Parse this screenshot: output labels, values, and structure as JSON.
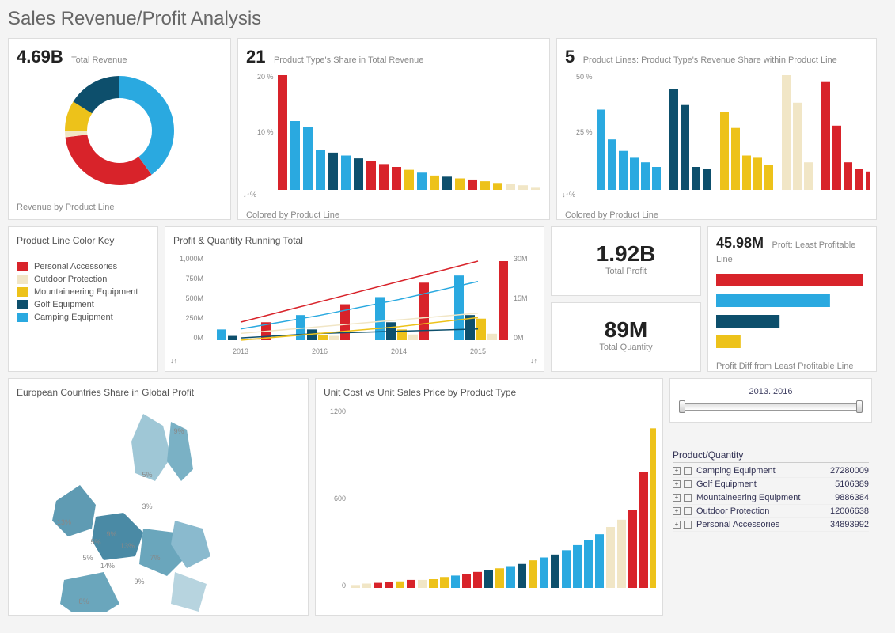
{
  "page_title": "Sales Revenue/Profit Analysis",
  "colors": {
    "red": "#d8232a",
    "cream": "#f1e6c6",
    "gold": "#edc21a",
    "navy": "#0d4f6c",
    "sky": "#2aa9e0"
  },
  "donut_card": {
    "kpi_value": "4.69B",
    "kpi_label": "Total Revenue",
    "caption": "Revenue by Product Line"
  },
  "share_card": {
    "kpi_value": "21",
    "kpi_label": "Product Type's Share in Total Revenue",
    "caption": "Colored by Product Line",
    "ymax_label": "20 %",
    "ymid_label": "10 %"
  },
  "lines_card": {
    "kpi_value": "5",
    "kpi_label": "Product Lines: Product Type's Revenue Share within Product Line",
    "caption": "Colored by Product Line",
    "ymax_label": "50 %",
    "ymid_label": "25 %"
  },
  "legend_card": {
    "title": "Product Line Color Key",
    "items": [
      {
        "label": "Personal Accessories",
        "color": "#d8232a"
      },
      {
        "label": "Outdoor Protection",
        "color": "#f1e6c6"
      },
      {
        "label": "Mountaineering Equipment",
        "color": "#edc21a"
      },
      {
        "label": "Golf Equipment",
        "color": "#0d4f6c"
      },
      {
        "label": "Camping Equipment",
        "color": "#2aa9e0"
      }
    ]
  },
  "running_card": {
    "title": "Profit & Quantity Running Total",
    "left_ticks": [
      "1,000M",
      "750M",
      "500M",
      "250M",
      "0M"
    ],
    "right_ticks": [
      "30M",
      "15M",
      "0M"
    ],
    "x_ticks": [
      "2013",
      "2016",
      "2014",
      "2015"
    ]
  },
  "total_profit": {
    "value": "1.92B",
    "label": "Total Profit"
  },
  "total_qty": {
    "value": "89M",
    "label": "Total Quantity"
  },
  "least_card": {
    "kpi_value": "45.98M",
    "kpi_label": "Proft: Least Profitable Line",
    "caption": "Profit Diff from Least Profitable Line"
  },
  "map_card": {
    "title": "European Countries Share in Global Profit"
  },
  "scatter_card": {
    "title": "Unit Cost vs Unit Sales Price by Product Type",
    "y_ticks": [
      "1200",
      "600",
      "0"
    ]
  },
  "slider": {
    "label": "2013..2016"
  },
  "tree": {
    "header": "Product/Quantity",
    "rows": [
      {
        "label": "Camping Equipment",
        "value": "27280009"
      },
      {
        "label": "Golf Equipment",
        "value": "5106389"
      },
      {
        "label": "Mountaineering Equipment",
        "value": "9886384"
      },
      {
        "label": "Outdoor Protection",
        "value": "12006638"
      },
      {
        "label": "Personal Accessories",
        "value": "34893992"
      }
    ]
  },
  "map_labels": [
    "9%",
    "5%",
    "3%",
    "13%",
    "9%",
    "5%",
    "13%",
    "7%",
    "14%",
    "5%",
    "9%",
    "8%"
  ],
  "chart_data": [
    {
      "type": "pie",
      "title": "Revenue by Product Line",
      "series": [
        {
          "name": "Personal Accessories",
          "value": 33,
          "color": "#d8232a"
        },
        {
          "name": "Outdoor Protection",
          "value": 2,
          "color": "#f1e6c6"
        },
        {
          "name": "Mountaineering Equipment",
          "value": 9,
          "color": "#edc21a"
        },
        {
          "name": "Golf Equipment",
          "value": 16,
          "color": "#0d4f6c"
        },
        {
          "name": "Camping Equipment",
          "value": 40,
          "color": "#2aa9e0"
        }
      ]
    },
    {
      "type": "bar",
      "title": "Product Type's Share in Total Revenue",
      "ylabel": "%",
      "ylim": [
        0,
        20
      ],
      "series": [
        {
          "name": "share",
          "values": [
            20,
            12,
            11,
            7,
            6.5,
            6,
            5.5,
            5,
            4.5,
            4,
            3.5,
            3,
            2.5,
            2.3,
            2,
            1.8,
            1.5,
            1.2,
            1,
            0.8,
            0.5
          ]
        }
      ],
      "colors": [
        "#d8232a",
        "#2aa9e0",
        "#2aa9e0",
        "#2aa9e0",
        "#0d4f6c",
        "#2aa9e0",
        "#0d4f6c",
        "#d8232a",
        "#d8232a",
        "#d8232a",
        "#edc21a",
        "#2aa9e0",
        "#edc21a",
        "#0d4f6c",
        "#edc21a",
        "#d8232a",
        "#edc21a",
        "#edc21a",
        "#f1e6c6",
        "#f1e6c6",
        "#f1e6c6"
      ]
    },
    {
      "type": "bar",
      "title": "Product Type's Revenue Share within Product Line",
      "ylabel": "%",
      "ylim": [
        0,
        50
      ],
      "groups": [
        "Camping",
        "Golf",
        "Mountaineering",
        "Outdoor",
        "Personal"
      ],
      "series": [
        {
          "name": "Camping",
          "color": "#2aa9e0",
          "values": [
            35,
            22,
            17,
            14,
            12,
            10
          ]
        },
        {
          "name": "Golf",
          "color": "#0d4f6c",
          "values": [
            44,
            37,
            10,
            9
          ]
        },
        {
          "name": "Mountaineering",
          "color": "#edc21a",
          "values": [
            34,
            27,
            15,
            14,
            11
          ]
        },
        {
          "name": "Outdoor",
          "color": "#f1e6c6",
          "values": [
            50,
            38,
            12
          ]
        },
        {
          "name": "Personal",
          "color": "#d8232a",
          "values": [
            47,
            28,
            12,
            9,
            8
          ]
        }
      ]
    },
    {
      "type": "bar",
      "title": "Profit & Quantity Running Total",
      "x": [
        "2013",
        "2016",
        "2014",
        "2015"
      ],
      "ylabel_left": "M",
      "ylim_left": [
        0,
        1000
      ],
      "ylabel_right": "M",
      "ylim_right": [
        0,
        30
      ],
      "series_bars": [
        {
          "name": "Camping",
          "color": "#2aa9e0",
          "values": [
            150,
            350,
            600,
            900
          ]
        },
        {
          "name": "Golf",
          "color": "#0d4f6c",
          "values": [
            60,
            150,
            250,
            350
          ]
        },
        {
          "name": "Mountaineering",
          "color": "#edc21a",
          "values": [
            0,
            70,
            150,
            300
          ]
        },
        {
          "name": "Outdoor",
          "color": "#f1e6c6",
          "values": [
            30,
            60,
            80,
            90
          ]
        },
        {
          "name": "Personal",
          "color": "#d8232a",
          "values": [
            250,
            500,
            800,
            1100
          ]
        }
      ],
      "series_lines": [
        {
          "name": "Camping",
          "color": "#2aa9e0",
          "values": [
            5,
            11,
            18,
            26
          ]
        },
        {
          "name": "Golf",
          "color": "#0d4f6c",
          "values": [
            1,
            3,
            4,
            5
          ]
        },
        {
          "name": "Mountaineering",
          "color": "#edc21a",
          "values": [
            0,
            3,
            6,
            10
          ]
        },
        {
          "name": "Outdoor",
          "color": "#f1e6c6",
          "values": [
            3,
            6,
            9,
            12
          ]
        },
        {
          "name": "Personal",
          "color": "#d8232a",
          "values": [
            8,
            17,
            26,
            35
          ]
        }
      ]
    },
    {
      "type": "bar",
      "title": "Profit Diff from Least Profitable Line",
      "categories": [
        "Personal Accessories",
        "Camping Equipment",
        "Golf Equipment",
        "Mountaineering Equipment"
      ],
      "values": [
        180,
        140,
        78,
        30
      ],
      "colors": [
        "#d8232a",
        "#2aa9e0",
        "#0d4f6c",
        "#edc21a"
      ]
    },
    {
      "type": "bar",
      "title": "Unit Cost vs Unit Sales Price by Product Type",
      "ylim": [
        0,
        1200
      ],
      "series": [
        {
          "name": "pair",
          "values": [
            20,
            30,
            35,
            40,
            45,
            55,
            55,
            60,
            75,
            85,
            95,
            110,
            125,
            135,
            150,
            165,
            190,
            210,
            230,
            260,
            295,
            330,
            370,
            420,
            470,
            540,
            800,
            1100
          ]
        }
      ],
      "colors": [
        "#f1e6c6",
        "#f1e6c6",
        "#d8232a",
        "#d8232a",
        "#edc21a",
        "#d8232a",
        "#f1e6c6",
        "#edc21a",
        "#edc21a",
        "#2aa9e0",
        "#d8232a",
        "#d8232a",
        "#0d4f6c",
        "#edc21a",
        "#2aa9e0",
        "#0d4f6c",
        "#edc21a",
        "#2aa9e0",
        "#0d4f6c",
        "#2aa9e0",
        "#2aa9e0",
        "#2aa9e0",
        "#2aa9e0"
      ]
    }
  ]
}
